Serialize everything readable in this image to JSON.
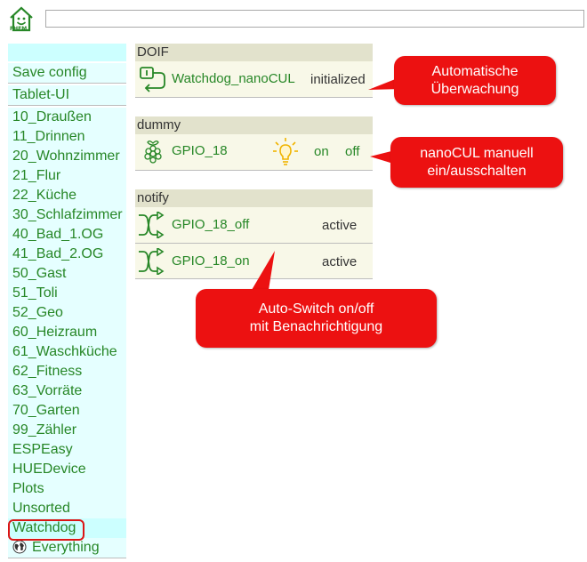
{
  "header": {
    "logo_label": "FHEM",
    "search_value": ""
  },
  "sidebar": {
    "top_items": [
      "Save config",
      "Tablet-UI"
    ],
    "rooms": [
      "10_Draußen",
      "11_Drinnen",
      "20_Wohnzimmer",
      "21_Flur",
      "22_Küche",
      "30_Schlafzimmer",
      "40_Bad_1.OG",
      "41_Bad_2.OG",
      "50_Gast",
      "51_Toli",
      "52_Geo",
      "60_Heizraum",
      "61_Waschküche",
      "62_Fitness",
      "63_Vorräte",
      "70_Garten",
      "99_Zähler",
      "ESPEasy",
      "HUEDevice",
      "Plots",
      "Unsorted",
      "Watchdog",
      "Everything"
    ],
    "selected": "Watchdog"
  },
  "panels": {
    "doif": {
      "header": "DOIF",
      "rows": [
        {
          "name": "Watchdog_nanoCUL",
          "state": "initialized",
          "icon": "doif-icon"
        }
      ]
    },
    "dummy": {
      "header": "dummy",
      "rows": [
        {
          "name": "GPIO_18",
          "icon": "raspberry-icon",
          "state_icon": "bulb-on-icon",
          "on": "on",
          "off": "off"
        }
      ]
    },
    "notify": {
      "header": "notify",
      "rows": [
        {
          "name": "GPIO_18_off",
          "state": "active",
          "icon": "notify-icon"
        },
        {
          "name": "GPIO_18_on",
          "state": "active",
          "icon": "notify-icon"
        }
      ]
    }
  },
  "callouts": {
    "c1": {
      "line1": "Automatische",
      "line2": "Überwachung"
    },
    "c2": {
      "line1": "nanoCUL manuell",
      "line2": "ein/ausschalten"
    },
    "c3": {
      "line1": "Auto-Switch on/off",
      "line2": "mit Benachrichtigung"
    }
  },
  "colors": {
    "link": "#278727",
    "callout": "#ec1111",
    "sidebar": "#e5ffff",
    "panel_header": "#e2e2cc",
    "highlight": "#dc1515"
  }
}
